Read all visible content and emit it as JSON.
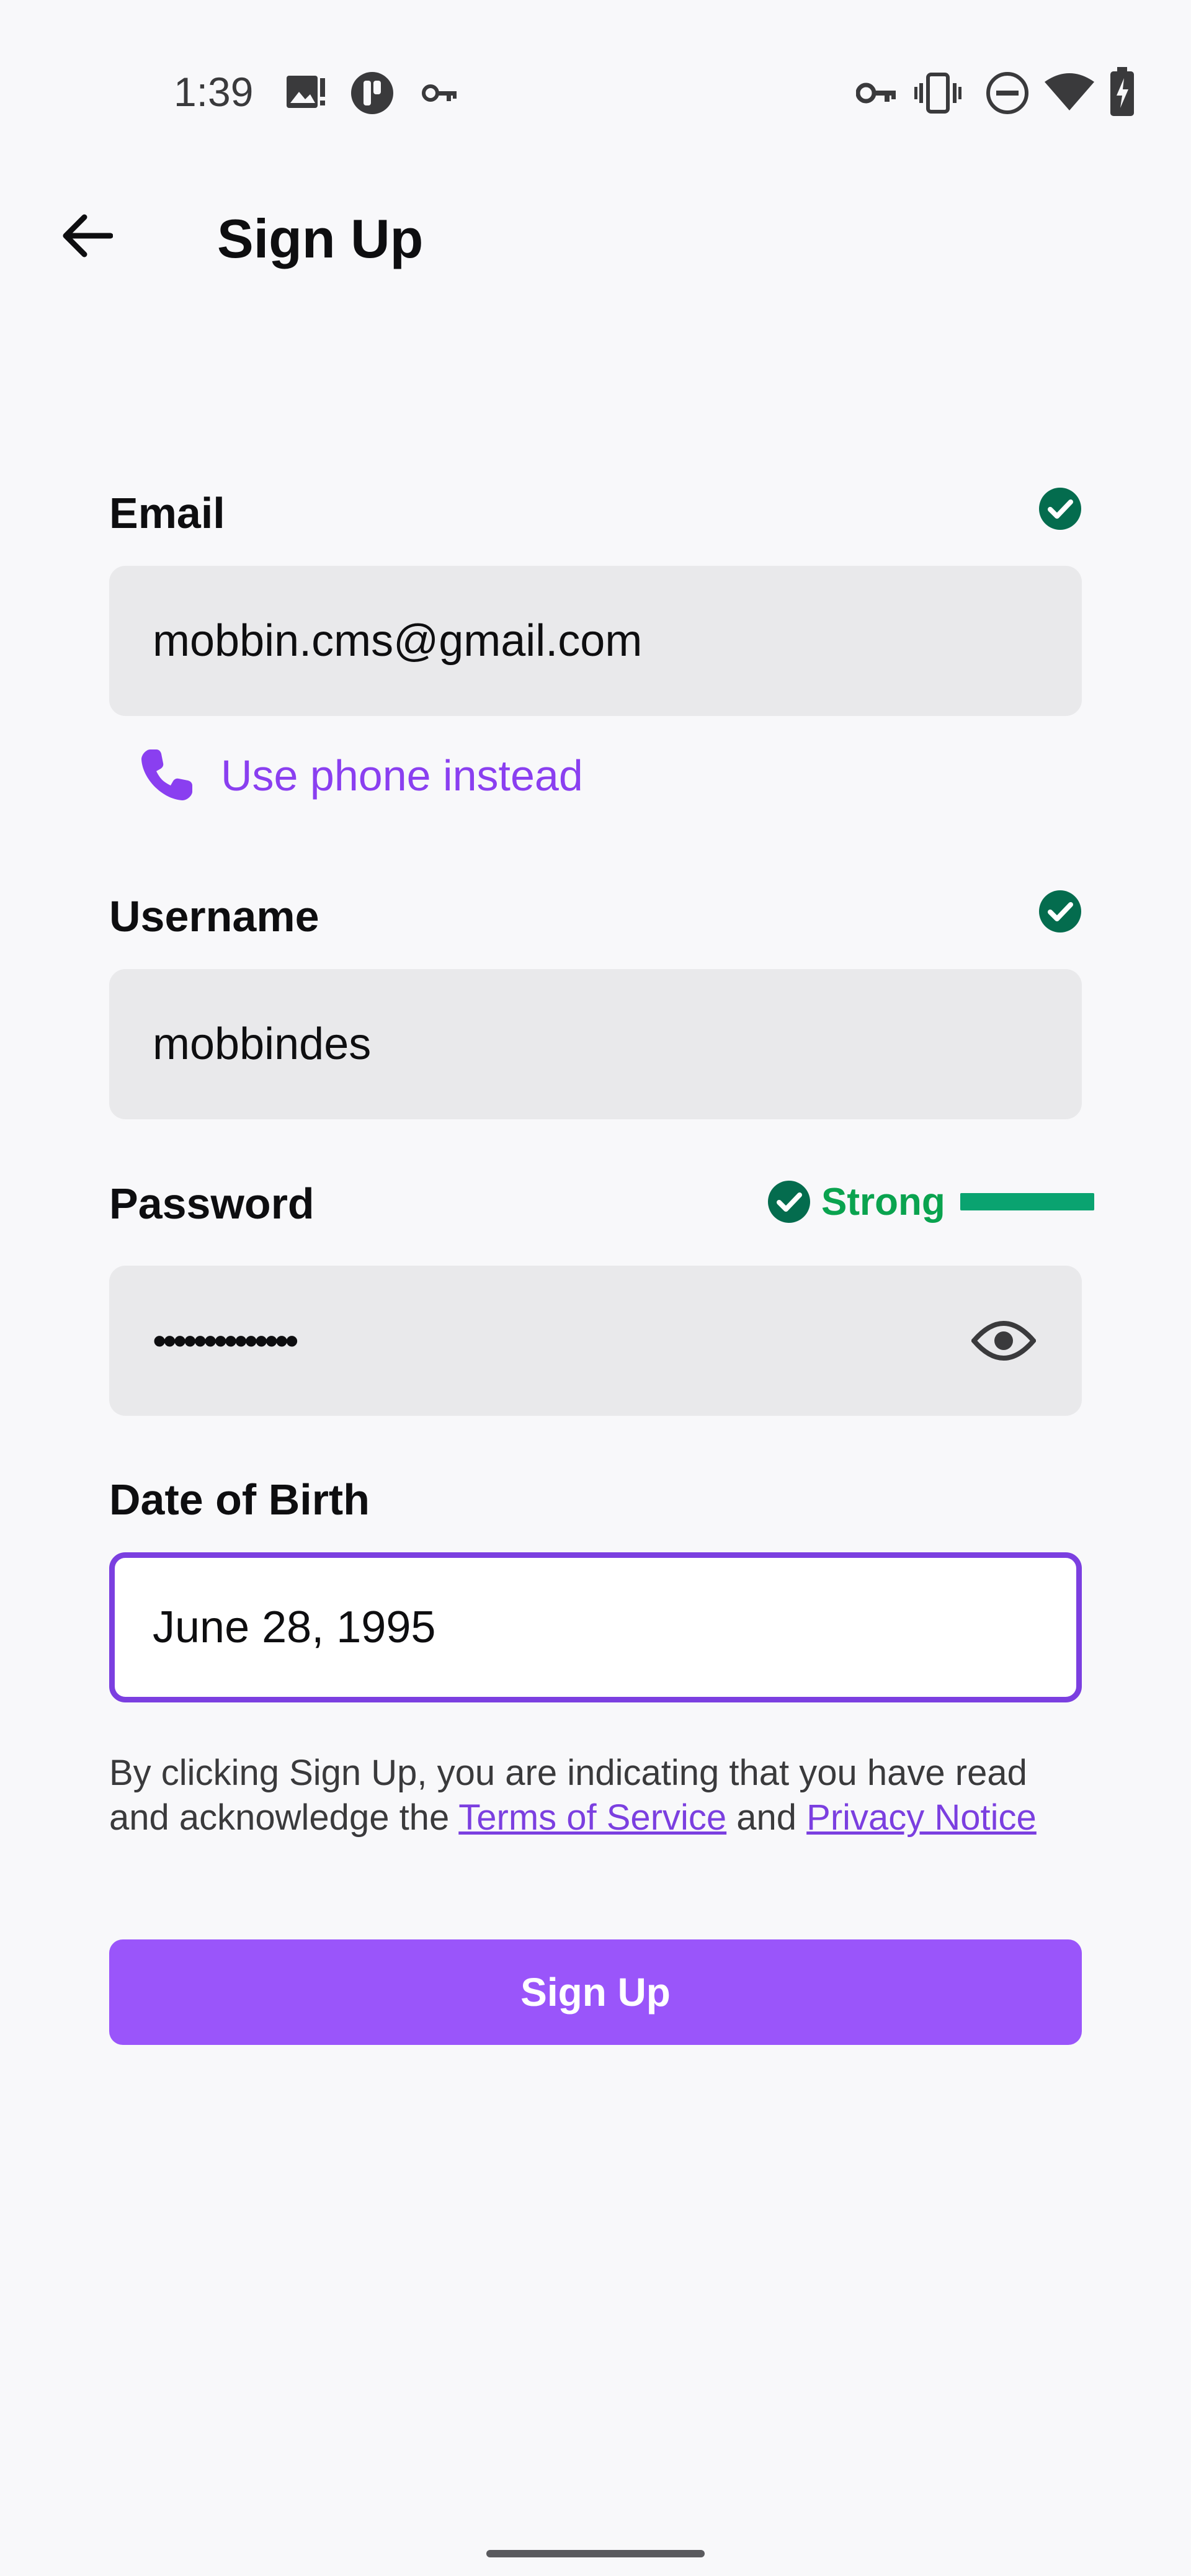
{
  "status_bar": {
    "time": "1:39",
    "left_icons": [
      "image-alert-icon",
      "app-badge-icon",
      "key-icon"
    ],
    "right_icons": [
      "vpn-key-icon",
      "vibrate-icon",
      "do-not-disturb-icon",
      "wifi-icon",
      "battery-charging-icon"
    ]
  },
  "app_bar": {
    "back_icon": "arrow-back-icon",
    "title": "Sign Up"
  },
  "form": {
    "email": {
      "label": "Email",
      "value": "mobbin.cms@gmail.com",
      "valid": true
    },
    "phone_link": {
      "icon": "phone-icon",
      "label": "Use phone instead"
    },
    "username": {
      "label": "Username",
      "value": "mobbindes",
      "valid": true
    },
    "password": {
      "label": "Password",
      "masked_value": "••••••••••••••",
      "strength_label": "Strong",
      "strength_level": 1.0,
      "visibility_icon": "eye-icon"
    },
    "dob": {
      "label": "Date of Birth",
      "value": "June 28, 1995",
      "focused": true
    }
  },
  "legal": {
    "text_before": "By clicking Sign Up, you are indicating that you have read and acknowledge the ",
    "terms_link": "Terms of Service",
    "text_middle": " and ",
    "privacy_link": "Privacy Notice"
  },
  "submit": {
    "label": "Sign Up"
  },
  "colors": {
    "accent": "#9a55fa",
    "accent_text": "#8a3ff0",
    "focus_border": "#7b3fe0",
    "valid_check": "#046c4e",
    "strength": "#0aa34f",
    "input_bg": "#e9e9eb",
    "page_bg": "#f8f8fa"
  }
}
